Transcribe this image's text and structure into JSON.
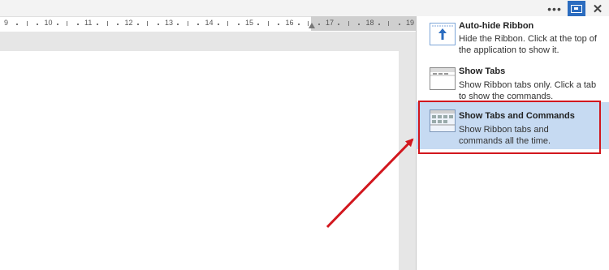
{
  "window_controls": {
    "more": "•••",
    "ribbon_options_icon": "ribbon-display-options-icon",
    "close": "✕"
  },
  "ruler": {
    "labels": [
      "9",
      "10",
      "11",
      "12",
      "13",
      "14",
      "15",
      "16",
      "17",
      "18",
      "19"
    ]
  },
  "ribbon_menu": {
    "items": [
      {
        "title": "Auto-hide Ribbon",
        "description": "Hide the Ribbon. Click at the top of the application to show it.",
        "icon": "auto-hide-ribbon-icon"
      },
      {
        "title": "Show Tabs",
        "description": "Show Ribbon tabs only. Click a tab to show the commands.",
        "icon": "show-tabs-icon"
      },
      {
        "title": "Show Tabs and Commands",
        "description": "Show Ribbon tabs and commands all the time.",
        "icon": "show-tabs-commands-icon",
        "selected": true
      }
    ]
  },
  "annotation": {
    "color": "#d2171e"
  }
}
